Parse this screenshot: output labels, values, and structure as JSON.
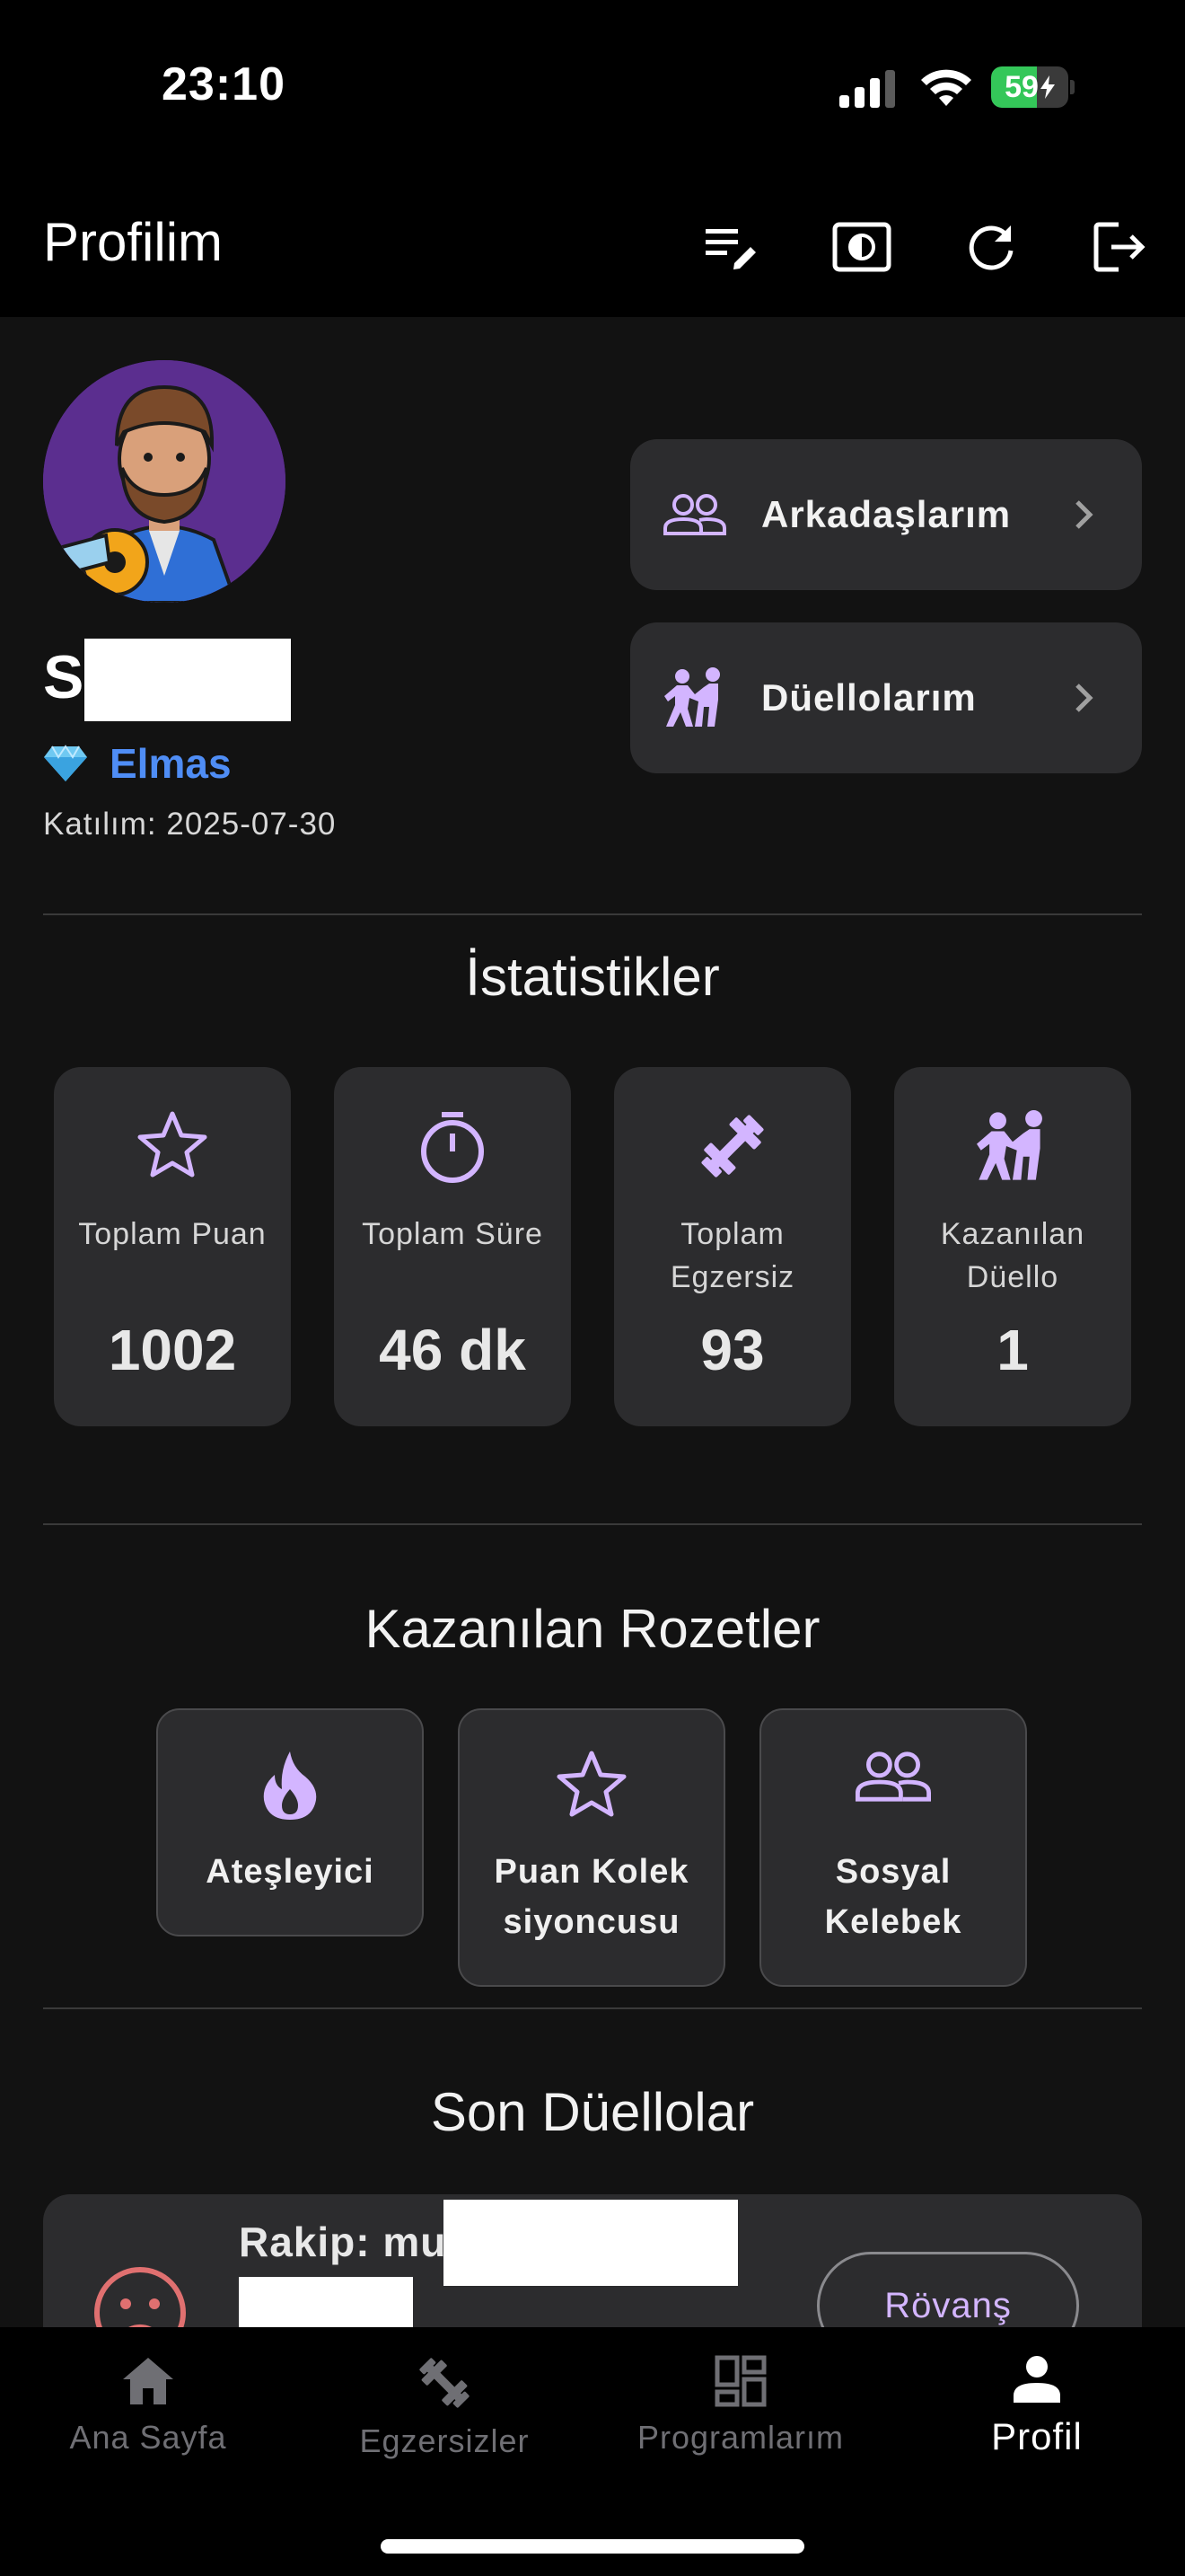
{
  "status_bar": {
    "time": "23:10",
    "battery": "59",
    "battery_level": 0.59
  },
  "app_bar": {
    "title": "Profilim",
    "actions": [
      "edit-list-icon",
      "contrast-icon",
      "refresh-icon",
      "logout-icon"
    ]
  },
  "profile": {
    "username_visible": "S",
    "rank_icon": "diamond-icon",
    "rank": "Elmas",
    "joined": "Katılım: 2025-07-30"
  },
  "side_buttons": [
    {
      "label": "Arkadaşlarım",
      "icon": "people-icon"
    },
    {
      "label": "Düellolarım",
      "icon": "duel-icon"
    }
  ],
  "stats": {
    "title": "İstatistikler",
    "cards": [
      {
        "label": "Toplam Puan",
        "value": "1002",
        "icon": "star-icon"
      },
      {
        "label": "Toplam Süre",
        "value": "46 dk",
        "icon": "timer-icon"
      },
      {
        "label": "Toplam Egzersiz",
        "value": "93",
        "icon": "dumbbell-icon"
      },
      {
        "label": "Kazanılan Düello",
        "value": "1",
        "icon": "duel-icon"
      }
    ]
  },
  "badges": {
    "title": "Kazanılan Rozetler",
    "items": [
      {
        "label": "Ateşleyici",
        "icon": "fire-icon"
      },
      {
        "label": "Puan Kolek siyoncusu",
        "icon": "star-icon"
      },
      {
        "label": "Sosyal Kelebek",
        "icon": "people-icon"
      }
    ]
  },
  "duels": {
    "title": "Son Düellolar",
    "items": [
      {
        "opponent_label": "Rakip: mu",
        "rematch_label": "Rövanş",
        "icon": "sad-face-icon"
      }
    ]
  },
  "bottom_nav": [
    {
      "label": "Ana Sayfa",
      "icon": "home-icon",
      "active": false
    },
    {
      "label": "Egzersizler",
      "icon": "dumbbell-icon",
      "active": false
    },
    {
      "label": "Programlarım",
      "icon": "dashboard-icon",
      "active": false
    },
    {
      "label": "Profil",
      "icon": "person-icon",
      "active": true
    }
  ],
  "colors": {
    "accent": "#d3b5ff",
    "rank": "#4f8df5",
    "card": "#2c2c2e",
    "background": "#121212",
    "battery": "#34c759"
  }
}
